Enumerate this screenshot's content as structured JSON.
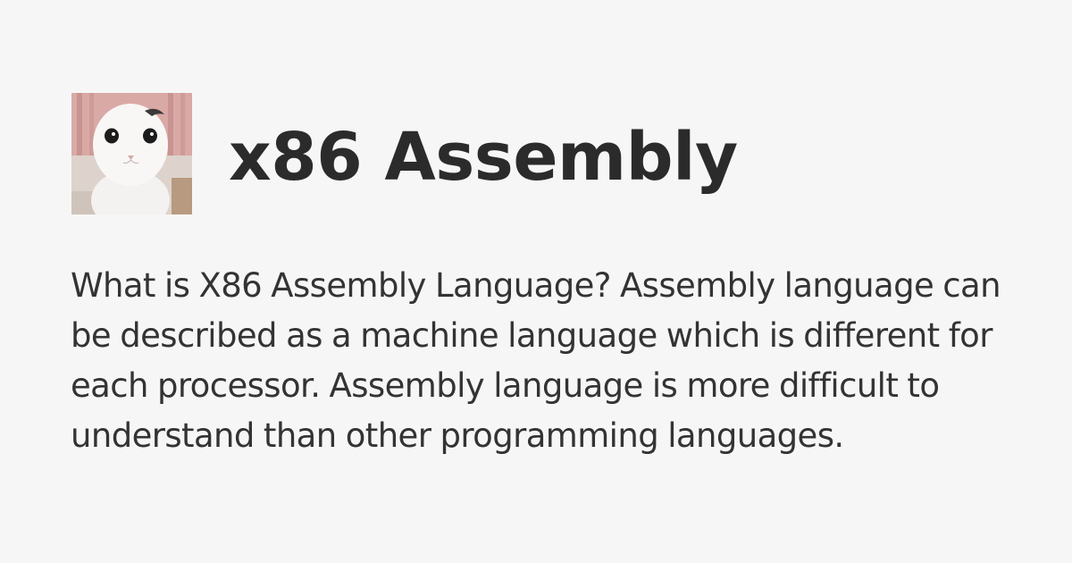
{
  "card": {
    "title": "x86 Assembly",
    "description": "What is X86 Assembly Language? Assembly language can be described as a machine language which is different for each processor. Assembly language is more difficult to understand than other programming languages.",
    "avatar_icon": "cat-avatar-icon"
  },
  "colors": {
    "background": "#f7f6f6",
    "title": "#2b2b2b",
    "text": "#333333"
  }
}
